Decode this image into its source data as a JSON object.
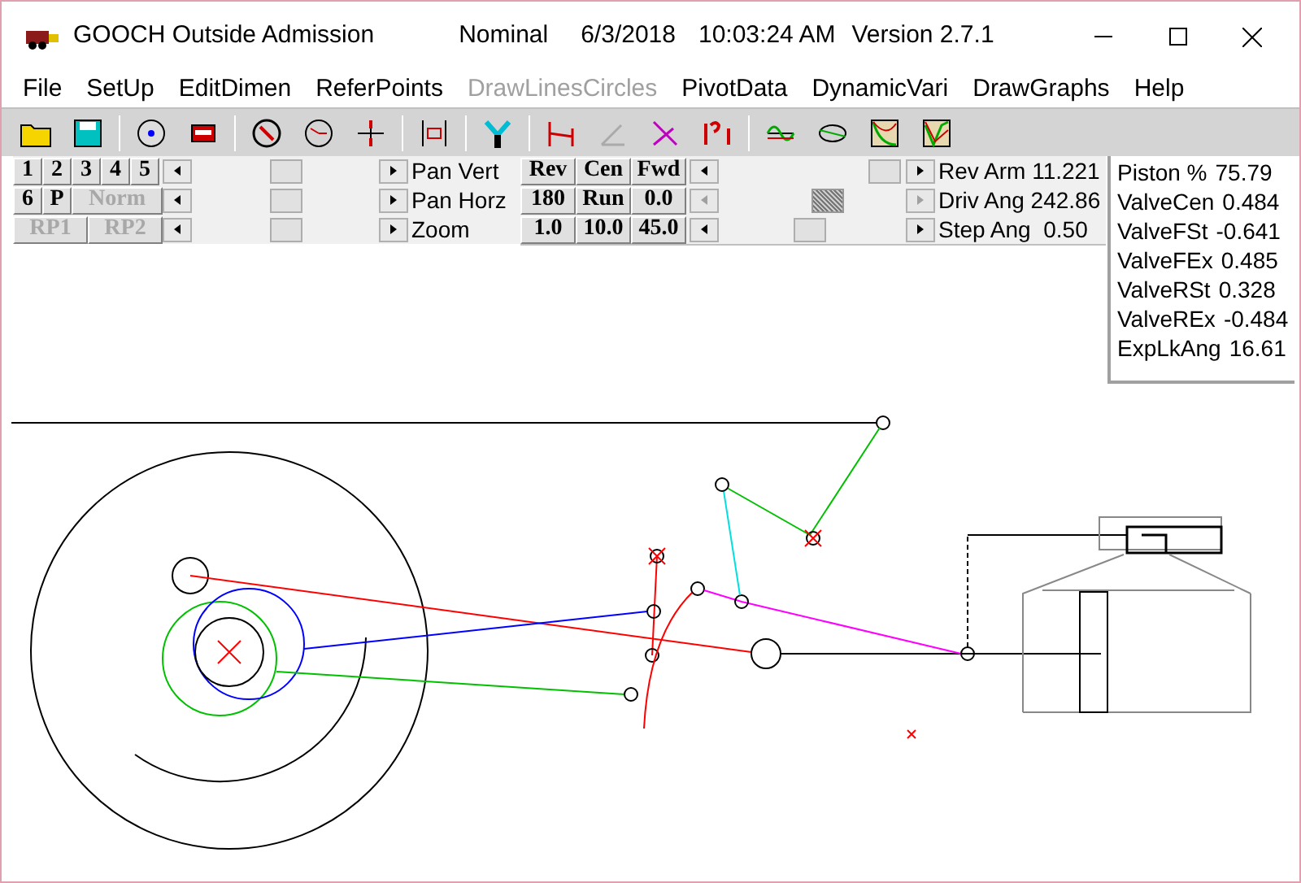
{
  "window": {
    "title": "GOOCH Outside Admission",
    "mode": "Nominal",
    "date": "6/3/2018",
    "time": "10:03:24 AM",
    "version": "Version 2.7.1"
  },
  "menu": [
    {
      "label": "File",
      "disabled": false
    },
    {
      "label": "SetUp",
      "disabled": false
    },
    {
      "label": "EditDimen",
      "disabled": false
    },
    {
      "label": "ReferPoints",
      "disabled": false
    },
    {
      "label": "DrawLinesCircles",
      "disabled": true
    },
    {
      "label": "PivotData",
      "disabled": false
    },
    {
      "label": "DynamicVari",
      "disabled": false
    },
    {
      "label": "DrawGraphs",
      "disabled": false
    },
    {
      "label": "Help",
      "disabled": false
    }
  ],
  "left_buttons": [
    [
      {
        "label": "1",
        "disabled": false
      },
      {
        "label": "2",
        "disabled": false
      },
      {
        "label": "3",
        "disabled": false
      },
      {
        "label": "4",
        "disabled": false
      },
      {
        "label": "5",
        "disabled": false
      }
    ],
    [
      {
        "label": "6",
        "disabled": false
      },
      {
        "label": "P",
        "disabled": false
      },
      {
        "label": "Norm",
        "disabled": true
      }
    ],
    [
      {
        "label": "RP1",
        "disabled": true
      },
      {
        "label": "RP2",
        "disabled": true
      }
    ]
  ],
  "left_sliders": [
    {
      "label": "Pan Vert",
      "level": 0.5,
      "disabled": false
    },
    {
      "label": "Pan Horz",
      "level": 0.5,
      "disabled": false
    },
    {
      "label": "Zoom",
      "level": 0.5,
      "disabled": false
    }
  ],
  "mid_buttons": [
    [
      {
        "label": "Rev"
      },
      {
        "label": "Cen"
      },
      {
        "label": "Fwd"
      }
    ],
    [
      {
        "label": "180"
      },
      {
        "label": "Run"
      },
      {
        "label": "0.0"
      }
    ],
    [
      {
        "label": "1.0"
      },
      {
        "label": "10.0"
      },
      {
        "label": "45.0"
      }
    ]
  ],
  "right_sliders": [
    {
      "label": "Rev Arm 11.221",
      "level": 0.97,
      "disabled": false
    },
    {
      "label": "Driv Ang 242.86",
      "level": 0.6,
      "disabled": true
    },
    {
      "label": "Step Ang  0.50",
      "level": 0.48,
      "disabled": false
    }
  ],
  "readouts": [
    {
      "label": "Piston %",
      "value": "75.79"
    },
    {
      "label": "ValveCen",
      "value": "0.484"
    },
    {
      "label": "ValveFSt",
      "value": "-0.641"
    },
    {
      "label": "ValveFEx",
      "value": "0.485"
    },
    {
      "label": "ValveRSt",
      "value": "0.328"
    },
    {
      "label": "ValveREx",
      "value": "-0.484"
    },
    {
      "label": "ExpLkAng",
      "value": "16.61"
    }
  ]
}
